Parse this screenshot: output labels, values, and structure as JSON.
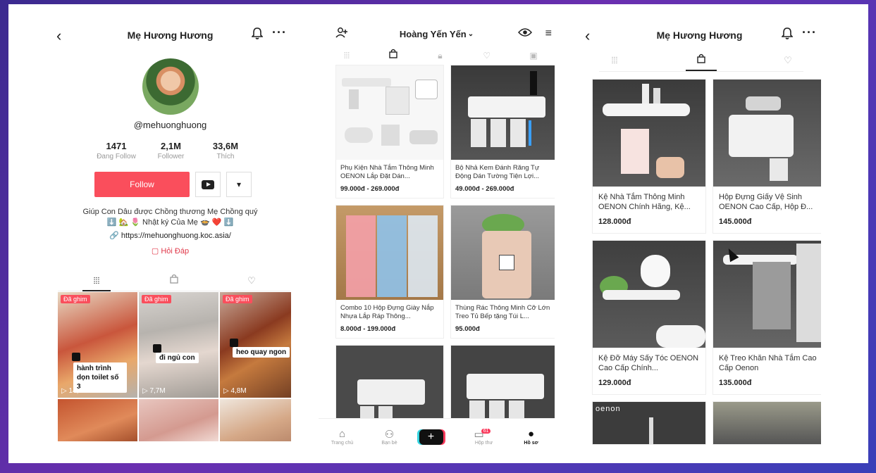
{
  "profile": {
    "title": "Mẹ Hương Hương",
    "handle": "@mehuonghuong",
    "stats": [
      {
        "value": "1471",
        "label": "Đang Follow"
      },
      {
        "value": "2,1M",
        "label": "Follower"
      },
      {
        "value": "33,6M",
        "label": "Thích"
      }
    ],
    "follow_label": "Follow",
    "more_label": "▾",
    "bio_line1": "Giúp Con Dâu được Chồng thương Mẹ Chồng quý",
    "bio_line2": "⬇️ 🏡 🌷  Nhật ký Của Mẹ 🍲 ❤️ ⬇️",
    "link": "https://mehuonghuong.koc.asia/",
    "hoi_dap": "Hỏi Đáp",
    "videos": [
      {
        "pinned": "Đã ghim",
        "caption": "hành trình dọn toilet số 3",
        "views": "14,2M"
      },
      {
        "pinned": "Đã ghim",
        "caption": "đi ngủ con",
        "views": "7,7M"
      },
      {
        "pinned": "Đã ghim",
        "caption": "heo quay ngon",
        "views": "4,8M"
      }
    ]
  },
  "shop": {
    "header_name": "Hoàng Yến Yến",
    "products": [
      {
        "name": "Phụ Kiện Nhà Tắm Thông Minh OENON Lắp Đặt Dán...",
        "price": "99.000đ - 269.000đ"
      },
      {
        "name": "Bộ Nhả Kem Đánh Răng Tự Động Dán Tường Tiện Lợi...",
        "price": "49.000đ - 269.000đ"
      },
      {
        "name": "Combo 10 Hộp Đựng Giày Nắp Nhựa Lắp Ráp Thông...",
        "price": "8.000đ - 199.000đ"
      },
      {
        "name": "Thùng Rác Thông Minh Cỡ Lớn Treo Tủ Bếp tặng Túi L...",
        "price": "95.000đ"
      }
    ],
    "nav": [
      {
        "icon": "home-icon",
        "label": "Trang chủ"
      },
      {
        "icon": "friends-icon",
        "label": "Bạn bè"
      },
      {
        "icon": "plus-icon",
        "label": "+"
      },
      {
        "icon": "inbox-icon",
        "label": "Hộp thư",
        "badge": "61"
      },
      {
        "icon": "profile-icon",
        "label": "Hồ sơ"
      }
    ]
  },
  "shop2": {
    "title": "Mẹ Hương Hương",
    "products": [
      {
        "name": "Kệ Nhà Tắm Thông Minh OENON Chính Hãng, Kệ...",
        "price": "128.000đ"
      },
      {
        "name": "Hộp Đựng Giấy Vệ Sinh OENON Cao Cấp, Hộp Đ...",
        "price": "145.000đ"
      },
      {
        "name": "Kệ Đỡ Máy Sấy Tóc OENON Cao Cấp Chính...",
        "price": "129.000đ"
      },
      {
        "name": "Kệ Treo Khăn Nhà Tắm Cao Cấp Oenon",
        "price": "135.000đ"
      }
    ],
    "brand": "oenon"
  },
  "colors": {
    "accent": "#fa4e5c",
    "link_red": "#e0394a"
  }
}
